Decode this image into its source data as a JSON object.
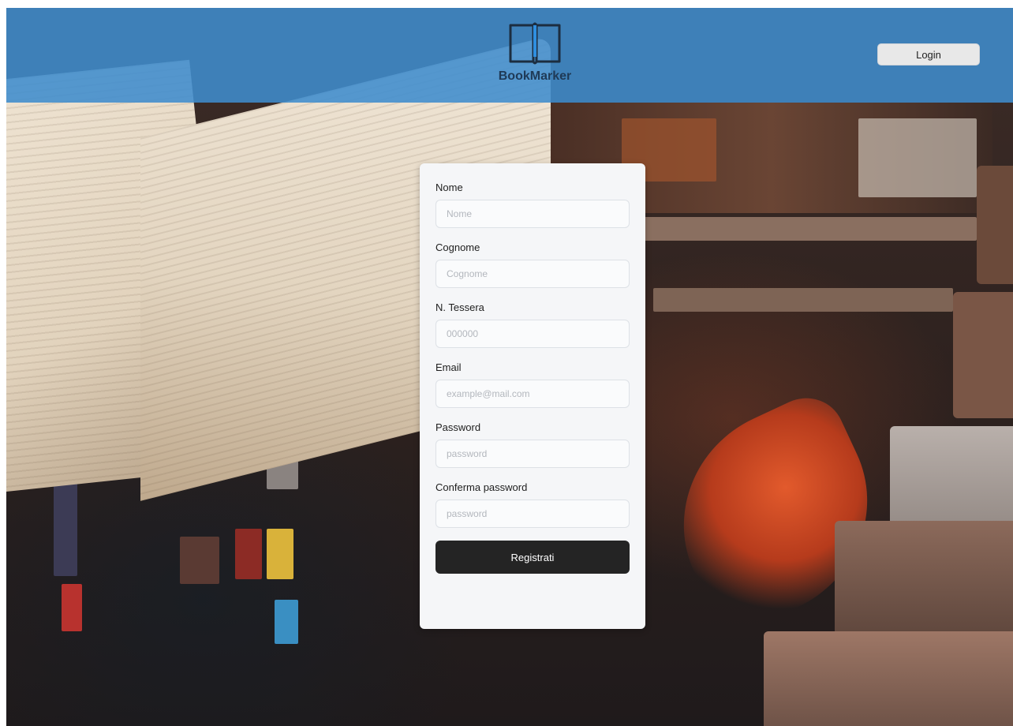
{
  "header": {
    "brand": "BookMarker",
    "login_label": "Login",
    "accent_color": "#3f8ccd"
  },
  "form": {
    "fields": [
      {
        "label": "Nome",
        "placeholder": "Nome",
        "type": "text"
      },
      {
        "label": "Cognome",
        "placeholder": "Cognome",
        "type": "text"
      },
      {
        "label": "N. Tessera",
        "placeholder": "000000",
        "type": "text"
      },
      {
        "label": "Email",
        "placeholder": "example@mail.com",
        "type": "email"
      },
      {
        "label": "Password",
        "placeholder": "password",
        "type": "password"
      },
      {
        "label": "Conferma password",
        "placeholder": "password",
        "type": "password"
      }
    ],
    "submit_label": "Registrati"
  }
}
